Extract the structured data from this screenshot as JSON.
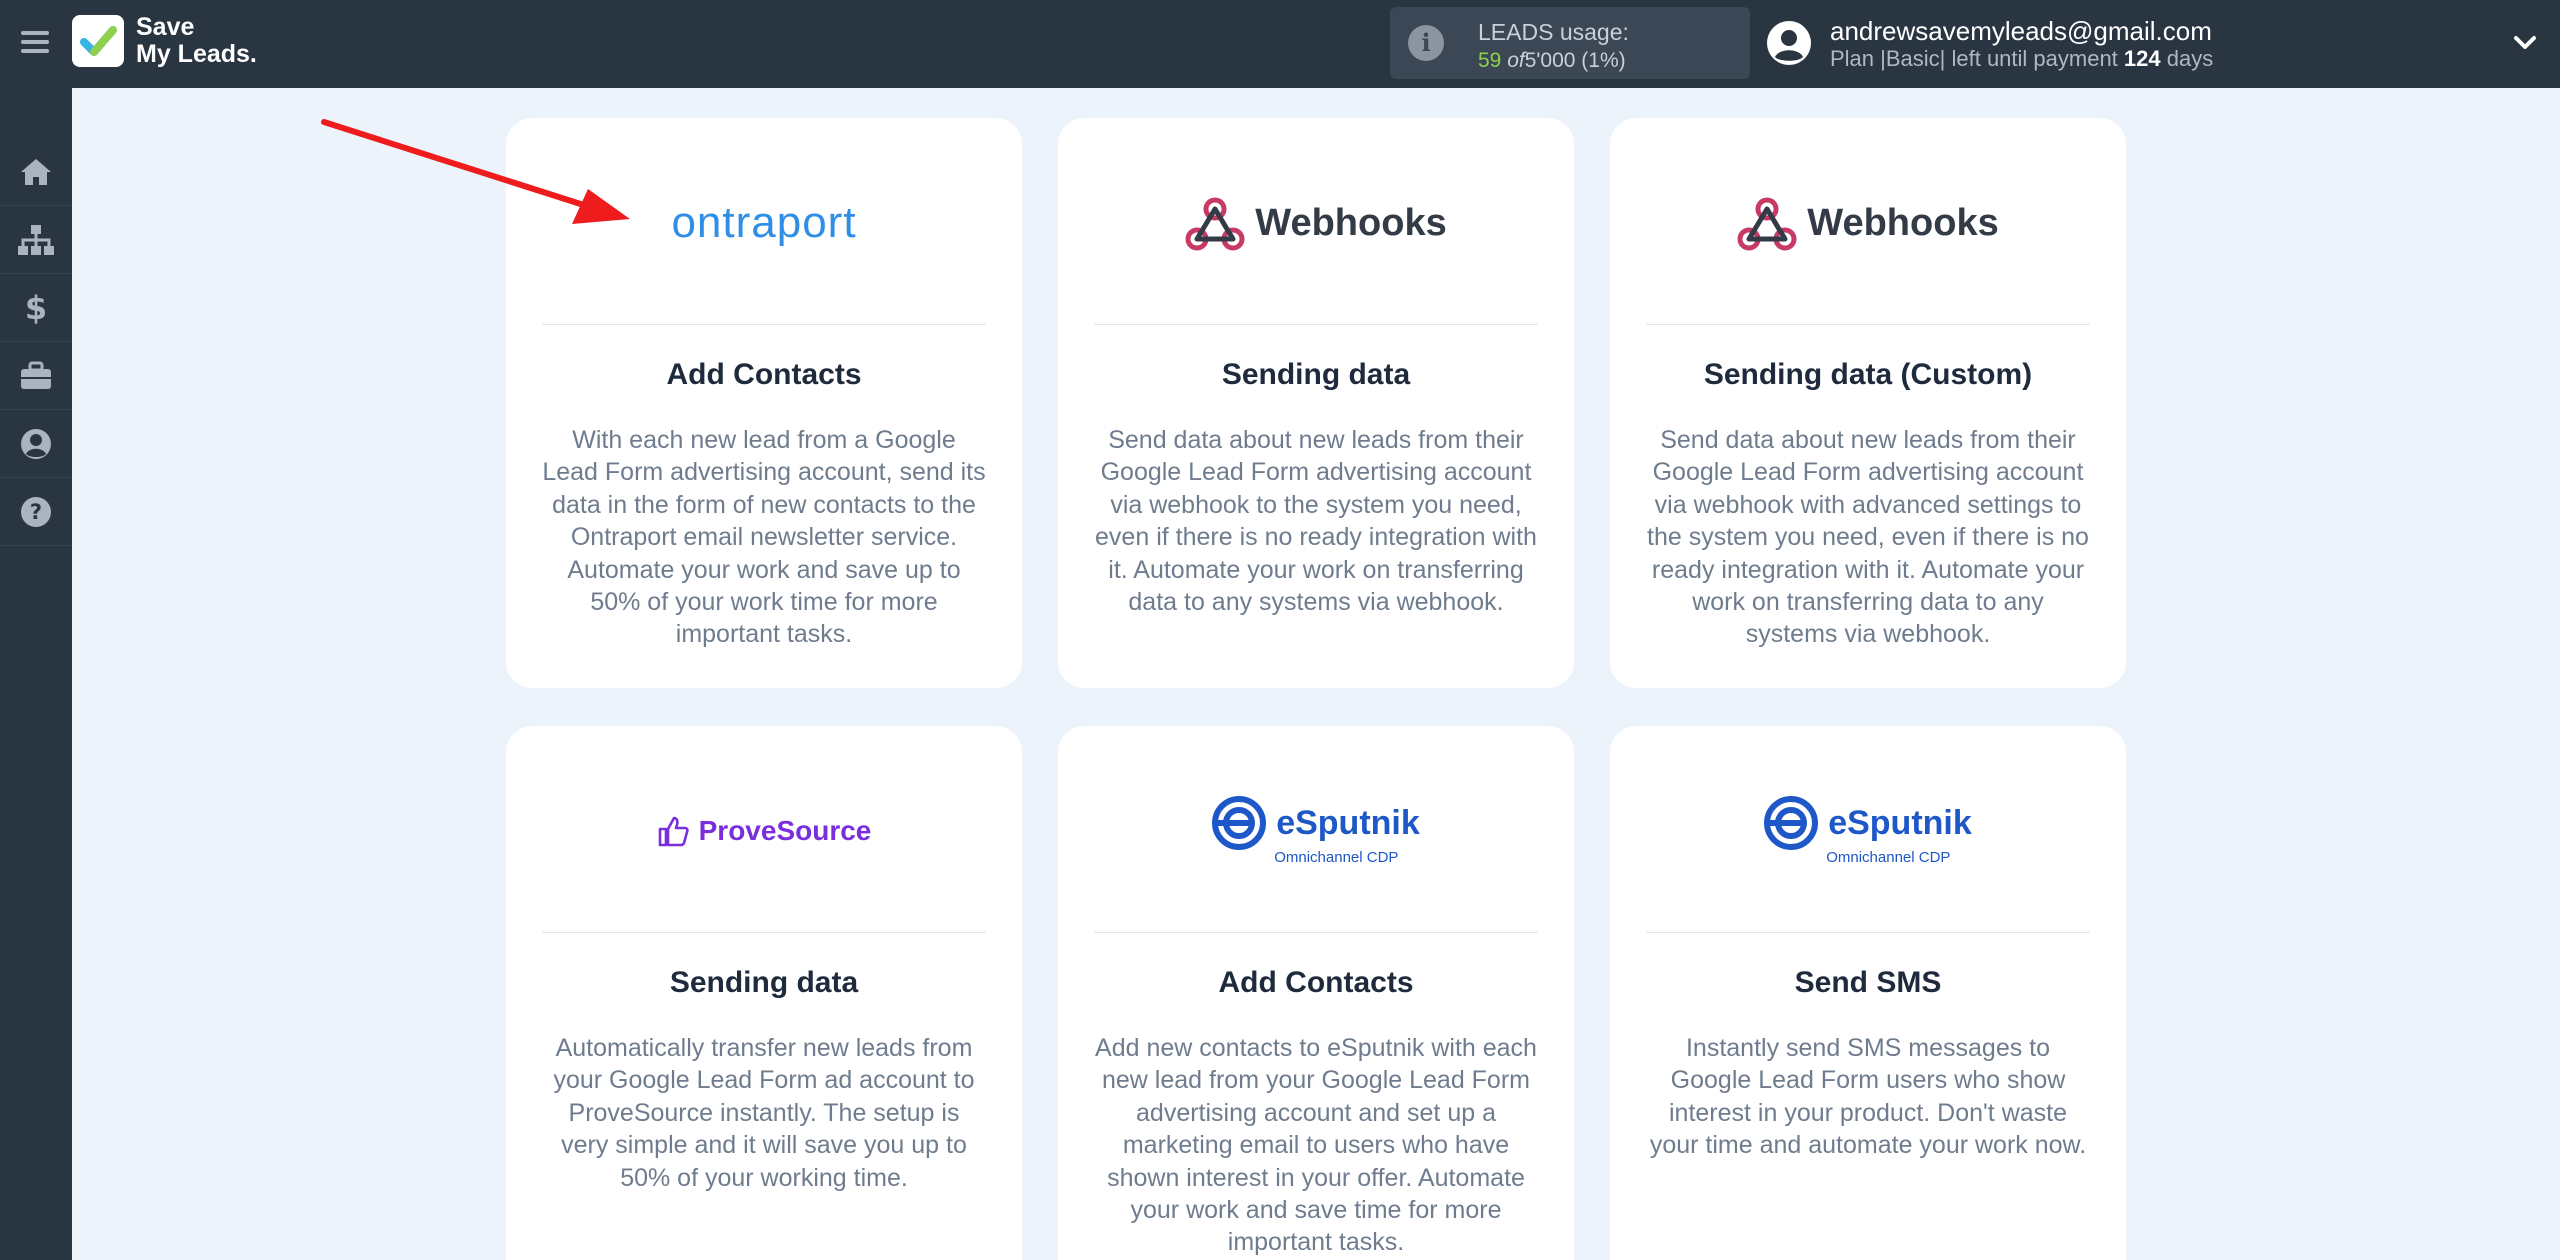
{
  "app": {
    "brand_line1": "Save",
    "brand_line2": "My Leads."
  },
  "usage": {
    "label": "LEADS usage:",
    "used": "59",
    "of": "of",
    "total": "5'000",
    "percent": "(1%)"
  },
  "user": {
    "email": "andrewsavemyleads@gmail.com",
    "plan_prefix": "Plan |",
    "plan_name": "Basic",
    "plan_suffix": "| left until payment",
    "days": "124",
    "days_unit": "days"
  },
  "sidebar": {
    "items": [
      {
        "icon": "home-icon"
      },
      {
        "icon": "sitemap-icon"
      },
      {
        "icon": "dollar-icon"
      },
      {
        "icon": "briefcase-icon"
      },
      {
        "icon": "user-circle-icon"
      },
      {
        "icon": "help-icon"
      }
    ]
  },
  "cards": [
    {
      "brand": "ontraport",
      "title": "Add Contacts",
      "description": "With each new lead from a Google Lead Form advertising account, send its data in the form of new contacts to the Ontraport email newsletter service. Automate your work and save up to 50% of your work time for more important tasks."
    },
    {
      "brand": "Webhooks",
      "title": "Sending data",
      "description": "Send data about new leads from their Google Lead Form advertising account via webhook to the system you need, even if there is no ready integration with it. Automate your work on transferring data to any systems via webhook."
    },
    {
      "brand": "Webhooks",
      "title": "Sending data (Custom)",
      "description": "Send data about new leads from their Google Lead Form advertising account via webhook with advanced settings to the system you need, even if there is no ready integration with it. Automate your work on transferring data to any systems via webhook."
    },
    {
      "brand": "ProveSource",
      "title": "Sending data",
      "description": "Automatically transfer new leads from your Google Lead Form ad account to ProveSource instantly. The setup is very simple and it will save you up to 50% of your working time."
    },
    {
      "brand": "eSputnik",
      "brand_sub": "Omnichannel CDP",
      "title": "Add Contacts",
      "description": "Add new contacts to eSputnik with each new lead from your Google Lead Form advertising account and set up a marketing email to users who have shown interest in your offer. Automate your work and save time for more important tasks."
    },
    {
      "brand": "eSputnik",
      "brand_sub": "Omnichannel CDP",
      "title": "Send SMS",
      "description": "Instantly send SMS messages to Google Lead Form users who show interest in your product. Don't waste your time and automate your work now."
    }
  ],
  "colors": {
    "topbar": "#2a3542",
    "page_bg": "#edf3fa",
    "annotation_arrow": "#ee1c1c",
    "usage_green": "#8fd14f"
  }
}
